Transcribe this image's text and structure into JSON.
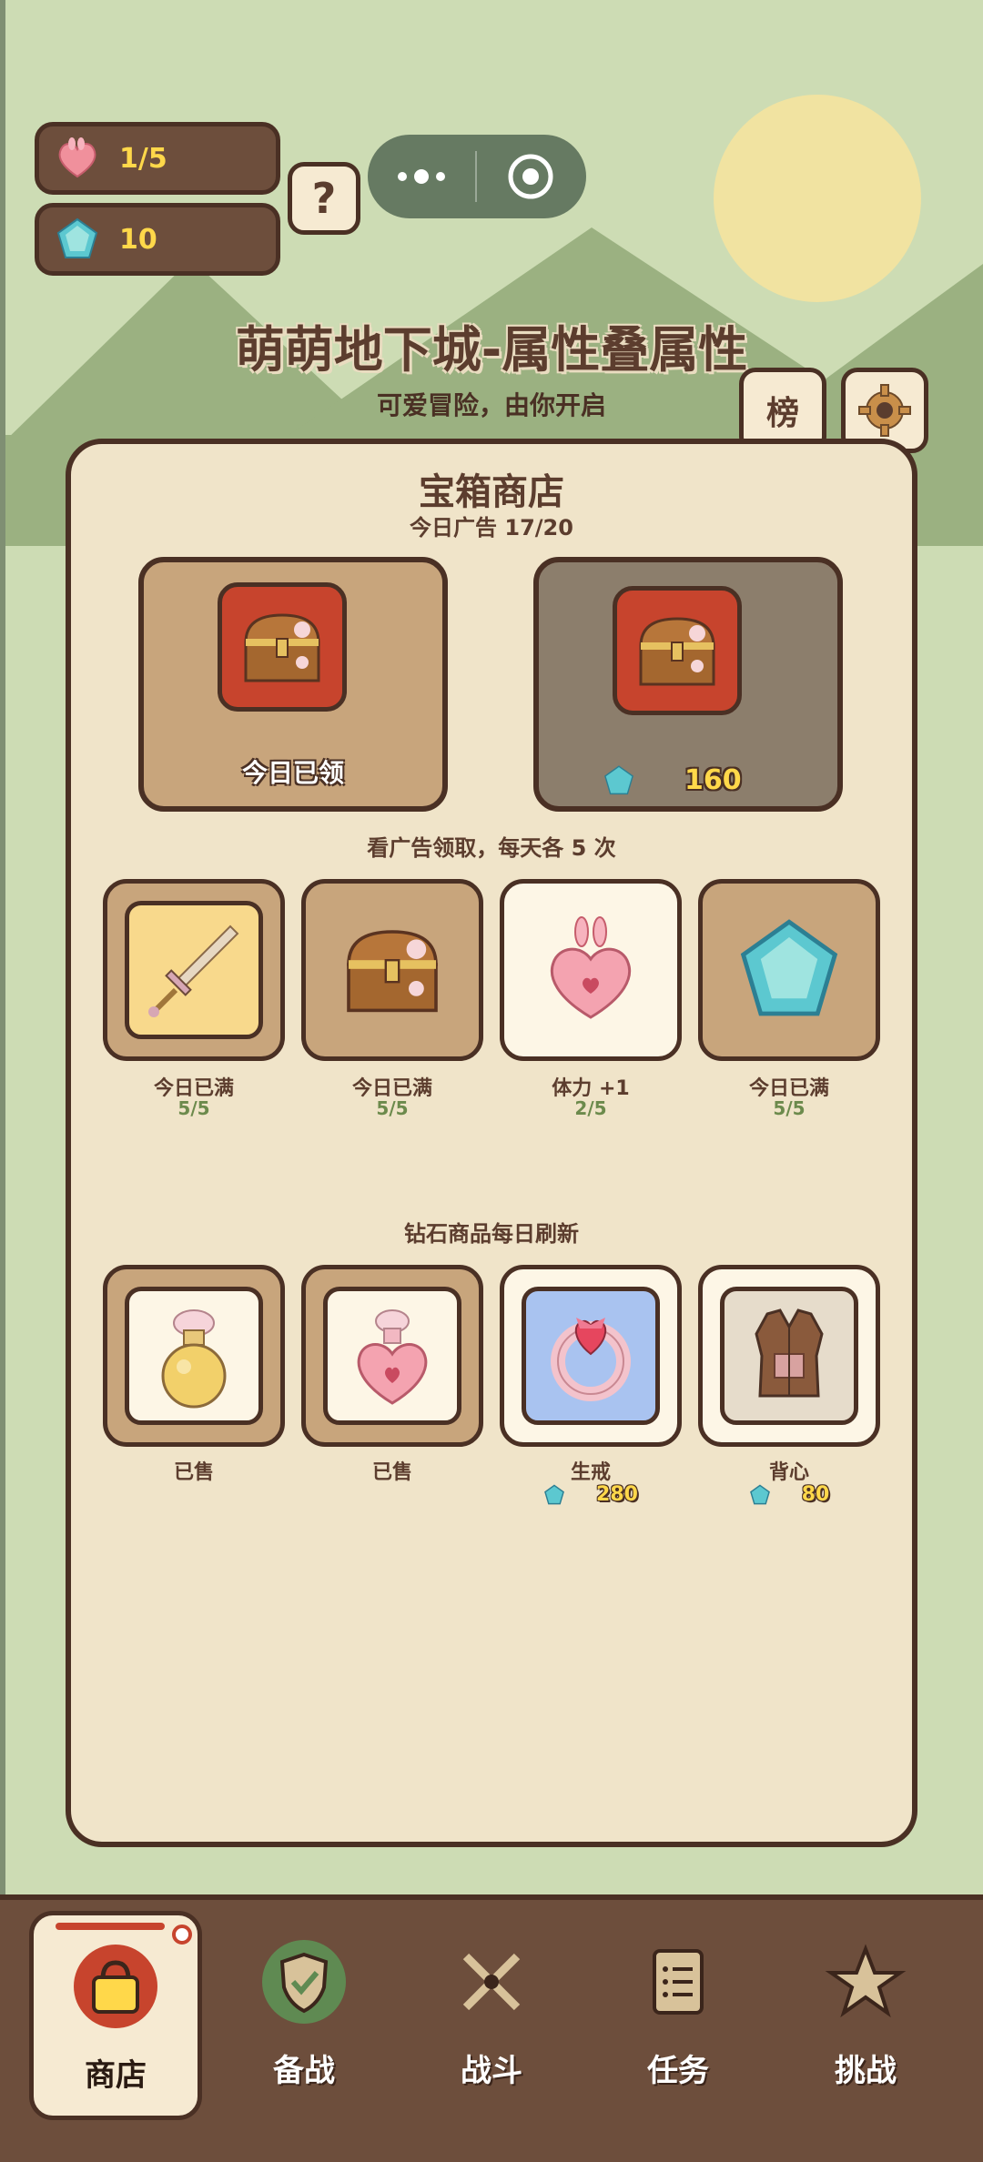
{
  "resources": {
    "stamina": "1/5",
    "diamonds": "10"
  },
  "help_label": "?",
  "header": {
    "title": "萌萌地下城-属性叠属性",
    "subtitle": "可爱冒险，由你开启",
    "rank_label": "榜"
  },
  "shop": {
    "title": "宝箱商店",
    "ads_today": "今日广告 17/20",
    "chest_left_label": "今日已领",
    "chest_right_price": "160",
    "ad_note": "看广告领取，每天各 5 次",
    "ad_items": [
      {
        "icon": "sword-icon",
        "label": "今日已满",
        "count": "5/5"
      },
      {
        "icon": "treasure-chest-icon",
        "label": "今日已满",
        "count": "5/5"
      },
      {
        "icon": "heart-potion-icon",
        "label": "体力 +1",
        "count": "2/5"
      },
      {
        "icon": "diamond-icon",
        "label": "今日已满",
        "count": "5/5"
      }
    ],
    "diamond_note": "钻石商品每日刷新",
    "diamond_items": [
      {
        "icon": "gold-potion-icon",
        "label": "已售",
        "price": ""
      },
      {
        "icon": "pink-potion-icon",
        "label": "已售",
        "price": ""
      },
      {
        "icon": "ring-icon",
        "label": "生戒",
        "price": "280"
      },
      {
        "icon": "vest-icon",
        "label": "背心",
        "price": "80"
      }
    ]
  },
  "nav": {
    "items": [
      {
        "label": "商店",
        "icon": "shop-bag-icon"
      },
      {
        "label": "备战",
        "icon": "shield-check-icon"
      },
      {
        "label": "战斗",
        "icon": "crossed-swords-icon"
      },
      {
        "label": "任务",
        "icon": "task-list-icon"
      },
      {
        "label": "挑战",
        "icon": "star-icon"
      }
    ]
  },
  "colors": {
    "brown_dark": "#4a3024",
    "panel": "#f0e4c9",
    "gold_text": "#ffd84a",
    "chest_red": "#c7442d"
  }
}
